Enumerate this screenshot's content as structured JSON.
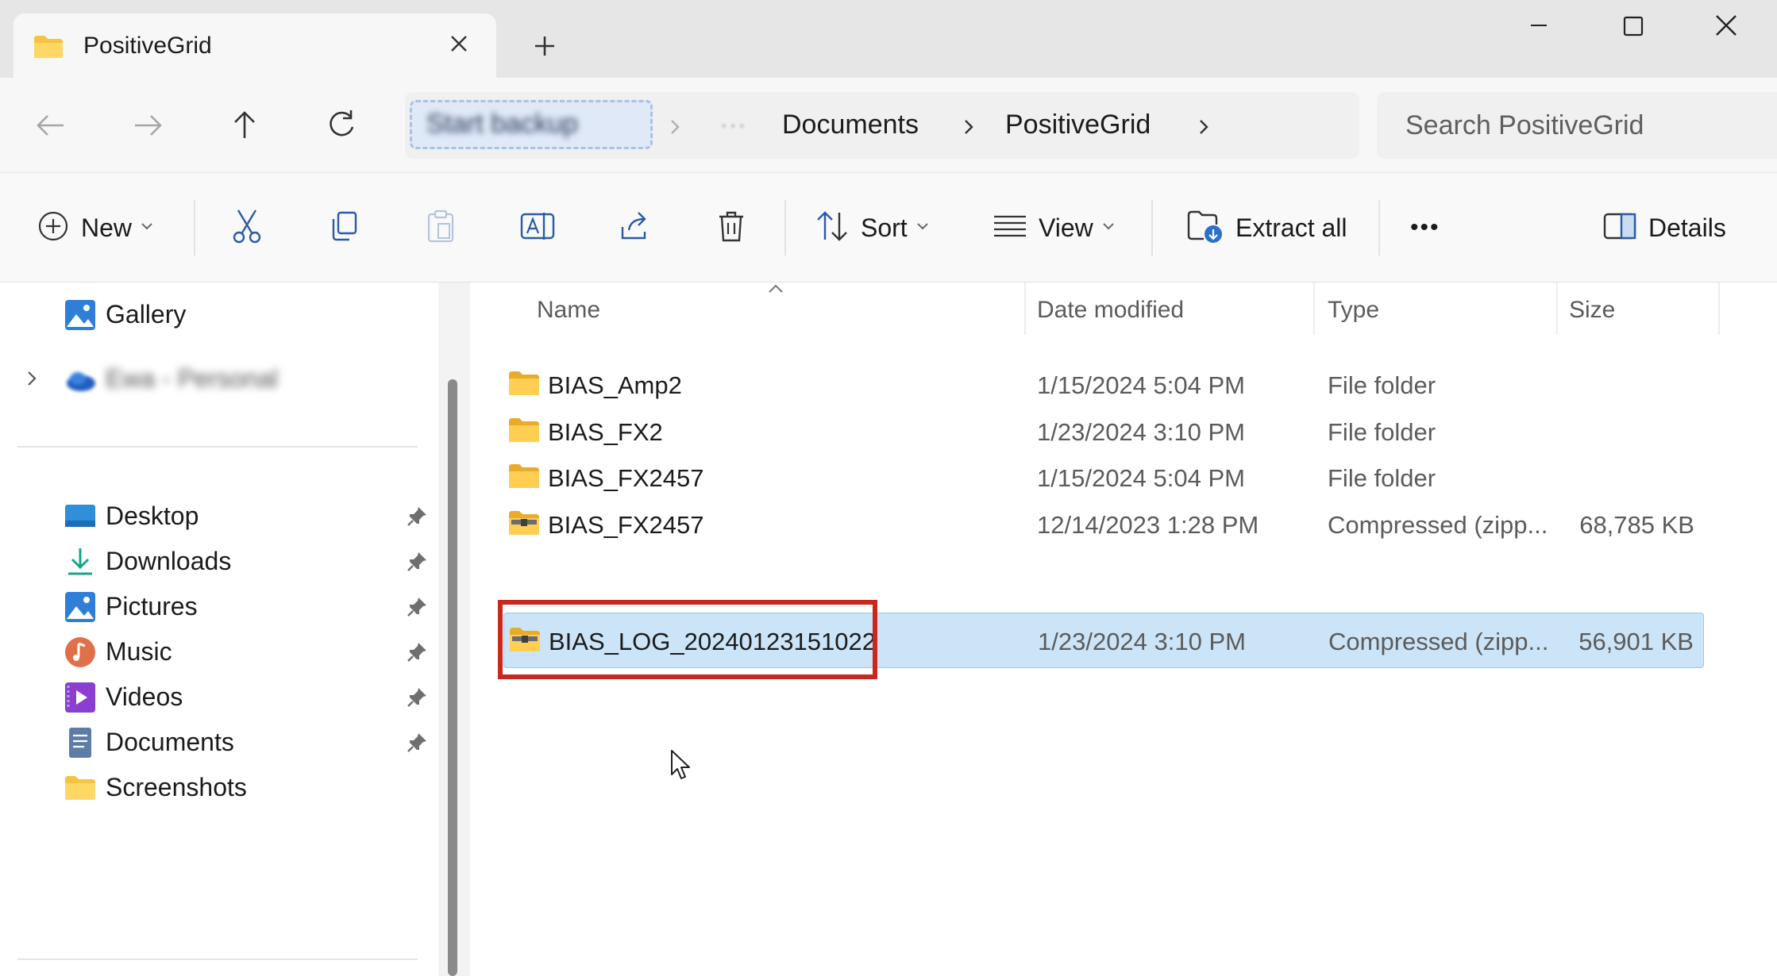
{
  "window": {
    "tab_title": "PositiveGrid",
    "controls": [
      "minimize",
      "maximize",
      "close"
    ]
  },
  "address": {
    "start_backup_label": "Start backup",
    "ellipsis": "···",
    "crumbs": [
      "Documents",
      "PositiveGrid"
    ],
    "search_placeholder": "Search PositiveGrid"
  },
  "commands": {
    "new": "New",
    "sort": "Sort",
    "view": "View",
    "extract_all": "Extract all",
    "more": "•••",
    "details": "Details"
  },
  "sidebar": {
    "top_items": [
      {
        "label": "Gallery",
        "icon": "gallery-icon"
      },
      {
        "label": "Ewa - Personal",
        "icon": "onedrive-cloud-icon"
      }
    ],
    "quick_access": [
      {
        "label": "Desktop",
        "icon": "desktop-icon",
        "pinned": true
      },
      {
        "label": "Downloads",
        "icon": "downloads-icon",
        "pinned": true
      },
      {
        "label": "Pictures",
        "icon": "pictures-icon",
        "pinned": true
      },
      {
        "label": "Music",
        "icon": "music-icon",
        "pinned": true
      },
      {
        "label": "Videos",
        "icon": "videos-icon",
        "pinned": true
      },
      {
        "label": "Documents",
        "icon": "documents-icon",
        "pinned": true
      },
      {
        "label": "Screenshots",
        "icon": "folder-icon",
        "pinned": false
      }
    ]
  },
  "files": {
    "columns": [
      "Name",
      "Date modified",
      "Type",
      "Size"
    ],
    "rows": [
      {
        "name": "BIAS_Amp2",
        "date": "1/15/2024 5:04 PM",
        "type": "File folder",
        "size": "",
        "kind": "folder"
      },
      {
        "name": "BIAS_FX2",
        "date": "1/23/2024 3:10 PM",
        "type": "File folder",
        "size": "",
        "kind": "folder"
      },
      {
        "name": "BIAS_FX2457",
        "date": "1/15/2024 5:04 PM",
        "type": "File folder",
        "size": "",
        "kind": "folder"
      },
      {
        "name": "BIAS_FX2457",
        "date": "12/14/2023 1:28 PM",
        "type": "Compressed (zipp...",
        "size": "68,785 KB",
        "kind": "zip"
      },
      {
        "name": "BIAS_LOG_20240123151022",
        "date": "1/23/2024 3:10 PM",
        "type": "Compressed (zipp...",
        "size": "56,901 KB",
        "kind": "zip",
        "selected": true
      }
    ]
  },
  "colors": {
    "selection": "#cce4f7",
    "highlight_box": "#c8281e",
    "folder": "#f6c343"
  }
}
